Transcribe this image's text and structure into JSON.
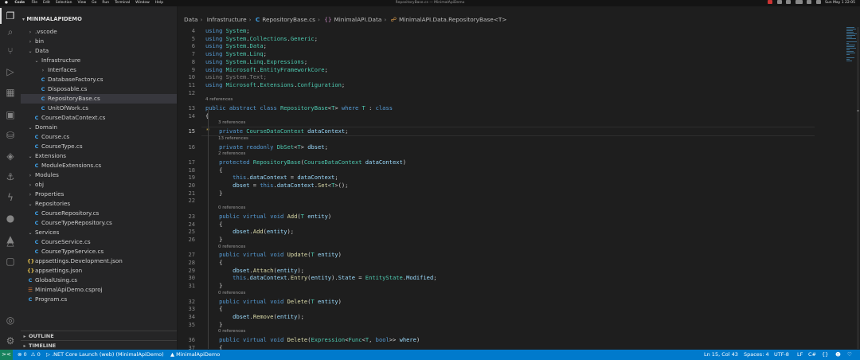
{
  "menubar": {
    "app": "Code",
    "items": [
      "File",
      "Edit",
      "Selection",
      "View",
      "Go",
      "Run",
      "Terminal",
      "Window",
      "Help"
    ],
    "title": "RepositoryBase.cs — MinimalApiDemo",
    "clock": "Sun May 1  22:05"
  },
  "activity_icons": [
    "files-icon",
    "search-icon",
    "source-control-icon",
    "run-debug-icon",
    "extensions-icon",
    "remote-explorer-icon",
    "database-icon",
    "layers-icon",
    "docker-icon",
    "azure-functions-icon",
    "github-icon",
    "deploy-icon",
    "azure-icon",
    "tabs-icon",
    "accounts-icon",
    "settings-gear-icon"
  ],
  "sidebar": {
    "project": "MINIMALAPIDEMO",
    "tree": [
      {
        "label": ".vscode",
        "kind": "folder",
        "open": false,
        "indent": 0
      },
      {
        "label": "bin",
        "kind": "folder",
        "open": false,
        "indent": 0
      },
      {
        "label": "Data",
        "kind": "folder",
        "open": true,
        "indent": 0
      },
      {
        "label": "Infrastructure",
        "kind": "folder",
        "open": true,
        "indent": 1
      },
      {
        "label": "Interfaces",
        "kind": "folder",
        "open": false,
        "indent": 2
      },
      {
        "label": "DatabaseFactory.cs",
        "kind": "cs",
        "indent": 2
      },
      {
        "label": "Disposable.cs",
        "kind": "cs",
        "indent": 2
      },
      {
        "label": "RepositoryBase.cs",
        "kind": "cs",
        "indent": 2,
        "selected": true
      },
      {
        "label": "UnitOfWork.cs",
        "kind": "cs",
        "indent": 2
      },
      {
        "label": "CourseDataContext.cs",
        "kind": "cs",
        "indent": 1
      },
      {
        "label": "Domain",
        "kind": "folder",
        "open": true,
        "indent": 0
      },
      {
        "label": "Course.cs",
        "kind": "cs",
        "indent": 1
      },
      {
        "label": "CourseType.cs",
        "kind": "cs",
        "indent": 1
      },
      {
        "label": "Extensions",
        "kind": "folder",
        "open": true,
        "indent": 0
      },
      {
        "label": "ModuleExtensions.cs",
        "kind": "cs",
        "indent": 1
      },
      {
        "label": "Modules",
        "kind": "folder",
        "open": false,
        "indent": 0
      },
      {
        "label": "obj",
        "kind": "folder",
        "open": false,
        "indent": 0
      },
      {
        "label": "Properties",
        "kind": "folder",
        "open": false,
        "indent": 0
      },
      {
        "label": "Repositories",
        "kind": "folder",
        "open": true,
        "indent": 0
      },
      {
        "label": "CourseRepository.cs",
        "kind": "cs",
        "indent": 1
      },
      {
        "label": "CourseTypeRepository.cs",
        "kind": "cs",
        "indent": 1
      },
      {
        "label": "Services",
        "kind": "folder",
        "open": true,
        "indent": 0
      },
      {
        "label": "CourseService.cs",
        "kind": "cs",
        "indent": 1
      },
      {
        "label": "CourseTypeService.cs",
        "kind": "cs",
        "indent": 1
      },
      {
        "label": "appsettings.Development.json",
        "kind": "json",
        "indent": 0
      },
      {
        "label": "appsettings.json",
        "kind": "json",
        "indent": 0
      },
      {
        "label": "GlobalUsing.cs",
        "kind": "cs",
        "indent": 0
      },
      {
        "label": "MinimalApiDemo.csproj",
        "kind": "csproj",
        "indent": 0
      },
      {
        "label": "Program.cs",
        "kind": "cs",
        "indent": 0
      }
    ],
    "sections": [
      "OUTLINE",
      "TIMELINE"
    ]
  },
  "breadcrumb": {
    "parts": [
      "Data",
      "Infrastructure",
      "RepositoryBase.cs",
      "MinimalAPI.Data",
      "MinimalAPI.Data.RepositoryBase<T>"
    ]
  },
  "code": [
    {
      "n": 4,
      "html": "<span class='k'>using</span> <span class='t'>System</span>;"
    },
    {
      "n": 5,
      "html": "<span class='k'>using</span> <span class='t'>System</span>.<span class='t'>Collections</span>.<span class='t'>Generic</span>;"
    },
    {
      "n": 6,
      "html": "<span class='k'>using</span> <span class='t'>System</span>.<span class='t'>Data</span>;"
    },
    {
      "n": 7,
      "html": "<span class='k'>using</span> <span class='t'>System</span>.<span class='t'>Linq</span>;"
    },
    {
      "n": 8,
      "html": "<span class='k'>using</span> <span class='t'>System</span>.<span class='t'>Linq</span>.<span class='t'>Expressions</span>;"
    },
    {
      "n": 9,
      "html": "<span class='k'>using</span> <span class='t'>Microsoft</span>.<span class='t'>EntityFrameworkCore</span>;"
    },
    {
      "n": 10,
      "html": "<span class='m'>using System.Text;</span>"
    },
    {
      "n": 11,
      "html": "<span class='k'>using</span> <span class='t'>Microsoft</span>.<span class='t'>Extensions</span>.<span class='t'>Configuration</span>;"
    },
    {
      "n": 12,
      "html": ""
    },
    {
      "lens": "4 references"
    },
    {
      "n": 13,
      "html": "<span class='k'>public</span> <span class='k'>abstract</span> <span class='k'>class</span> <span class='t'>RepositoryBase</span>&lt;<span class='t'>T</span>&gt; <span class='k'>where</span> <span class='t'>T</span> : <span class='k'>class</span>"
    },
    {
      "n": 14,
      "html": "{"
    },
    {
      "lens": "3 references",
      "indent": 2
    },
    {
      "n": 15,
      "current": true,
      "bulb": true,
      "html": "    <span class='k'>private</span> <span class='t'>CourseDataContext</span> <span class='v'>dataContext</span>;"
    },
    {
      "lens": "13 references",
      "indent": 2
    },
    {
      "n": 16,
      "html": "    <span class='k'>private</span> <span class='k'>readonly</span> <span class='t'>DbSet</span>&lt;<span class='t'>T</span>&gt; <span class='v'>dbset</span>;"
    },
    {
      "lens": "2 references",
      "indent": 2
    },
    {
      "n": 17,
      "html": "    <span class='k'>protected</span> <span class='t'>RepositoryBase</span>(<span class='t'>CourseDataContext</span> <span class='v'>dataContext</span>)"
    },
    {
      "n": 18,
      "html": "    {"
    },
    {
      "n": 19,
      "html": "        <span class='k'>this</span>.<span class='v'>dataContext</span> = <span class='v'>dataContext</span>;"
    },
    {
      "n": 20,
      "html": "        <span class='v'>dbset</span> = <span class='k'>this</span>.<span class='v'>dataContext</span>.<span class='f'>Set</span>&lt;<span class='t'>T</span>&gt;();"
    },
    {
      "n": 21,
      "html": "    }"
    },
    {
      "n": 22,
      "html": ""
    },
    {
      "lens": "0 references",
      "indent": 2
    },
    {
      "n": 23,
      "html": "    <span class='k'>public</span> <span class='k'>virtual</span> <span class='k'>void</span> <span class='f'>Add</span>(<span class='t'>T</span> <span class='v'>entity</span>)"
    },
    {
      "n": 24,
      "html": "    {"
    },
    {
      "n": 25,
      "html": "        <span class='v'>dbset</span>.<span class='f'>Add</span>(<span class='v'>entity</span>);"
    },
    {
      "n": 26,
      "html": "    }"
    },
    {
      "lens": "0 references",
      "indent": 2
    },
    {
      "n": 27,
      "html": "    <span class='k'>public</span> <span class='k'>virtual</span> <span class='k'>void</span> <span class='f'>Update</span>(<span class='t'>T</span> <span class='v'>entity</span>)"
    },
    {
      "n": 28,
      "html": "    {"
    },
    {
      "n": 29,
      "html": "        <span class='v'>dbset</span>.<span class='f'>Attach</span>(<span class='v'>entity</span>);"
    },
    {
      "n": 30,
      "html": "        <span class='k'>this</span>.<span class='v'>dataContext</span>.<span class='f'>Entry</span>(<span class='v'>entity</span>).<span class='v'>State</span> = <span class='t'>EntityState</span>.<span class='v'>Modified</span>;"
    },
    {
      "n": 31,
      "html": "    }"
    },
    {
      "lens": "0 references",
      "indent": 2
    },
    {
      "n": 32,
      "html": "    <span class='k'>public</span> <span class='k'>virtual</span> <span class='k'>void</span> <span class='f'>Delete</span>(<span class='t'>T</span> <span class='v'>entity</span>)"
    },
    {
      "n": 33,
      "html": "    {"
    },
    {
      "n": 34,
      "html": "        <span class='v'>dbset</span>.<span class='f'>Remove</span>(<span class='v'>entity</span>);"
    },
    {
      "n": 35,
      "html": "    }"
    },
    {
      "lens": "0 references",
      "indent": 2
    },
    {
      "n": 36,
      "html": "    <span class='k'>public</span> <span class='k'>virtual</span> <span class='k'>void</span> <span class='f'>Delete</span>(<span class='t'>Expression</span>&lt;<span class='t'>Func</span>&lt;<span class='t'>T</span>, <span class='k'>bool</span>&gt;&gt; <span class='v'>where</span>)"
    },
    {
      "n": 37,
      "html": "    {"
    }
  ],
  "statusbar": {
    "errors": "0",
    "warnings": "0",
    "launch": ".NET Core Launch (web) (MinimalApiDemo)",
    "project": "MinimalApiDemo",
    "position": "Ln 15, Col 43",
    "spaces": "Spaces: 4",
    "encoding": "UTF-8",
    "eol": "LF",
    "language": "C#"
  }
}
